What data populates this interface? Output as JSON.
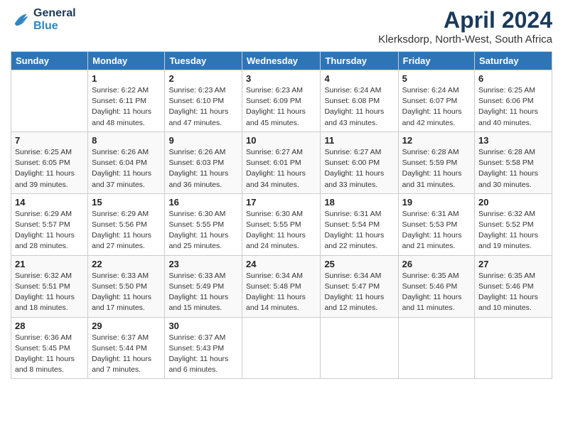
{
  "header": {
    "logo_line1": "General",
    "logo_line2": "Blue",
    "title": "April 2024",
    "subtitle": "Klerksdorp, North-West, South Africa"
  },
  "calendar": {
    "days_of_week": [
      "Sunday",
      "Monday",
      "Tuesday",
      "Wednesday",
      "Thursday",
      "Friday",
      "Saturday"
    ],
    "weeks": [
      [
        {
          "day": "",
          "sunrise": "",
          "sunset": "",
          "daylight": ""
        },
        {
          "day": "1",
          "sunrise": "Sunrise: 6:22 AM",
          "sunset": "Sunset: 6:11 PM",
          "daylight": "Daylight: 11 hours and 48 minutes."
        },
        {
          "day": "2",
          "sunrise": "Sunrise: 6:23 AM",
          "sunset": "Sunset: 6:10 PM",
          "daylight": "Daylight: 11 hours and 47 minutes."
        },
        {
          "day": "3",
          "sunrise": "Sunrise: 6:23 AM",
          "sunset": "Sunset: 6:09 PM",
          "daylight": "Daylight: 11 hours and 45 minutes."
        },
        {
          "day": "4",
          "sunrise": "Sunrise: 6:24 AM",
          "sunset": "Sunset: 6:08 PM",
          "daylight": "Daylight: 11 hours and 43 minutes."
        },
        {
          "day": "5",
          "sunrise": "Sunrise: 6:24 AM",
          "sunset": "Sunset: 6:07 PM",
          "daylight": "Daylight: 11 hours and 42 minutes."
        },
        {
          "day": "6",
          "sunrise": "Sunrise: 6:25 AM",
          "sunset": "Sunset: 6:06 PM",
          "daylight": "Daylight: 11 hours and 40 minutes."
        }
      ],
      [
        {
          "day": "7",
          "sunrise": "Sunrise: 6:25 AM",
          "sunset": "Sunset: 6:05 PM",
          "daylight": "Daylight: 11 hours and 39 minutes."
        },
        {
          "day": "8",
          "sunrise": "Sunrise: 6:26 AM",
          "sunset": "Sunset: 6:04 PM",
          "daylight": "Daylight: 11 hours and 37 minutes."
        },
        {
          "day": "9",
          "sunrise": "Sunrise: 6:26 AM",
          "sunset": "Sunset: 6:03 PM",
          "daylight": "Daylight: 11 hours and 36 minutes."
        },
        {
          "day": "10",
          "sunrise": "Sunrise: 6:27 AM",
          "sunset": "Sunset: 6:01 PM",
          "daylight": "Daylight: 11 hours and 34 minutes."
        },
        {
          "day": "11",
          "sunrise": "Sunrise: 6:27 AM",
          "sunset": "Sunset: 6:00 PM",
          "daylight": "Daylight: 11 hours and 33 minutes."
        },
        {
          "day": "12",
          "sunrise": "Sunrise: 6:28 AM",
          "sunset": "Sunset: 5:59 PM",
          "daylight": "Daylight: 11 hours and 31 minutes."
        },
        {
          "day": "13",
          "sunrise": "Sunrise: 6:28 AM",
          "sunset": "Sunset: 5:58 PM",
          "daylight": "Daylight: 11 hours and 30 minutes."
        }
      ],
      [
        {
          "day": "14",
          "sunrise": "Sunrise: 6:29 AM",
          "sunset": "Sunset: 5:57 PM",
          "daylight": "Daylight: 11 hours and 28 minutes."
        },
        {
          "day": "15",
          "sunrise": "Sunrise: 6:29 AM",
          "sunset": "Sunset: 5:56 PM",
          "daylight": "Daylight: 11 hours and 27 minutes."
        },
        {
          "day": "16",
          "sunrise": "Sunrise: 6:30 AM",
          "sunset": "Sunset: 5:55 PM",
          "daylight": "Daylight: 11 hours and 25 minutes."
        },
        {
          "day": "17",
          "sunrise": "Sunrise: 6:30 AM",
          "sunset": "Sunset: 5:55 PM",
          "daylight": "Daylight: 11 hours and 24 minutes."
        },
        {
          "day": "18",
          "sunrise": "Sunrise: 6:31 AM",
          "sunset": "Sunset: 5:54 PM",
          "daylight": "Daylight: 11 hours and 22 minutes."
        },
        {
          "day": "19",
          "sunrise": "Sunrise: 6:31 AM",
          "sunset": "Sunset: 5:53 PM",
          "daylight": "Daylight: 11 hours and 21 minutes."
        },
        {
          "day": "20",
          "sunrise": "Sunrise: 6:32 AM",
          "sunset": "Sunset: 5:52 PM",
          "daylight": "Daylight: 11 hours and 19 minutes."
        }
      ],
      [
        {
          "day": "21",
          "sunrise": "Sunrise: 6:32 AM",
          "sunset": "Sunset: 5:51 PM",
          "daylight": "Daylight: 11 hours and 18 minutes."
        },
        {
          "day": "22",
          "sunrise": "Sunrise: 6:33 AM",
          "sunset": "Sunset: 5:50 PM",
          "daylight": "Daylight: 11 hours and 17 minutes."
        },
        {
          "day": "23",
          "sunrise": "Sunrise: 6:33 AM",
          "sunset": "Sunset: 5:49 PM",
          "daylight": "Daylight: 11 hours and 15 minutes."
        },
        {
          "day": "24",
          "sunrise": "Sunrise: 6:34 AM",
          "sunset": "Sunset: 5:48 PM",
          "daylight": "Daylight: 11 hours and 14 minutes."
        },
        {
          "day": "25",
          "sunrise": "Sunrise: 6:34 AM",
          "sunset": "Sunset: 5:47 PM",
          "daylight": "Daylight: 11 hours and 12 minutes."
        },
        {
          "day": "26",
          "sunrise": "Sunrise: 6:35 AM",
          "sunset": "Sunset: 5:46 PM",
          "daylight": "Daylight: 11 hours and 11 minutes."
        },
        {
          "day": "27",
          "sunrise": "Sunrise: 6:35 AM",
          "sunset": "Sunset: 5:46 PM",
          "daylight": "Daylight: 11 hours and 10 minutes."
        }
      ],
      [
        {
          "day": "28",
          "sunrise": "Sunrise: 6:36 AM",
          "sunset": "Sunset: 5:45 PM",
          "daylight": "Daylight: 11 hours and 8 minutes."
        },
        {
          "day": "29",
          "sunrise": "Sunrise: 6:37 AM",
          "sunset": "Sunset: 5:44 PM",
          "daylight": "Daylight: 11 hours and 7 minutes."
        },
        {
          "day": "30",
          "sunrise": "Sunrise: 6:37 AM",
          "sunset": "Sunset: 5:43 PM",
          "daylight": "Daylight: 11 hours and 6 minutes."
        },
        {
          "day": "",
          "sunrise": "",
          "sunset": "",
          "daylight": ""
        },
        {
          "day": "",
          "sunrise": "",
          "sunset": "",
          "daylight": ""
        },
        {
          "day": "",
          "sunrise": "",
          "sunset": "",
          "daylight": ""
        },
        {
          "day": "",
          "sunrise": "",
          "sunset": "",
          "daylight": ""
        }
      ]
    ]
  }
}
